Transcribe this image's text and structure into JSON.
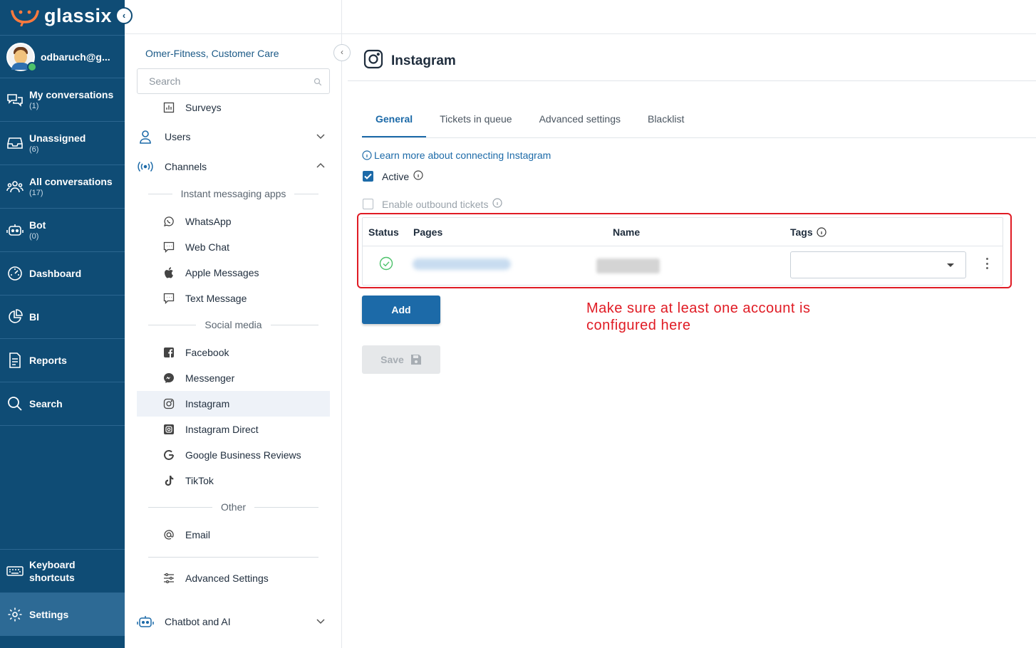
{
  "app": {
    "brand": "glassix",
    "user": "odbaruch@g..."
  },
  "nav": {
    "items": [
      {
        "label": "My conversations",
        "count": "(1)",
        "icon": "chat-icon"
      },
      {
        "label": "Unassigned",
        "count": "(6)",
        "icon": "inbox-icon"
      },
      {
        "label": "All conversations",
        "count": "(17)",
        "icon": "users-icon"
      },
      {
        "label": "Bot",
        "count": "(0)",
        "icon": "bot-icon"
      },
      {
        "label": "Dashboard",
        "count": "",
        "icon": "dashboard-icon"
      },
      {
        "label": "BI",
        "count": "",
        "icon": "pie-chart-icon"
      },
      {
        "label": "Reports",
        "count": "",
        "icon": "report-icon"
      },
      {
        "label": "Search",
        "count": "",
        "icon": "search-icon"
      }
    ],
    "keyboard_line1": "Keyboard",
    "keyboard_line2": "shortcuts",
    "settings": "Settings"
  },
  "panel": {
    "org": "Omer-Fitness, Customer Care",
    "search_placeholder": "Search",
    "surveys": "Surveys",
    "users": "Users",
    "channels": "Channels",
    "im_header": "Instant messaging apps",
    "im_items": [
      "WhatsApp",
      "Web Chat",
      "Apple Messages",
      "Text Message"
    ],
    "social_header": "Social media",
    "social_items": [
      "Facebook",
      "Messenger",
      "Instagram",
      "Instagram Direct",
      "Google Business Reviews",
      "TikTok"
    ],
    "other_header": "Other",
    "email": "Email",
    "advanced": "Advanced Settings",
    "chatbot": "Chatbot and AI"
  },
  "main": {
    "title": "Instagram",
    "tabs": [
      "General",
      "Tickets in queue",
      "Advanced settings",
      "Blacklist"
    ],
    "active_tab": "General",
    "learn_more": "Learn more about connecting Instagram",
    "active_label": "Active",
    "active_checked": true,
    "outbound_label": "Enable outbound tickets",
    "outbound_checked": false,
    "table": {
      "columns": [
        "Status",
        "Pages",
        "Name",
        "Tags"
      ],
      "rows": [
        {
          "status": "connected",
          "tags": ""
        }
      ]
    },
    "add_button": "Add",
    "save_button": "Save",
    "annotation": "Make sure at least one account is configured here"
  },
  "colors": {
    "nav_bg": "#0f4c75",
    "accent": "#1c6aa8",
    "annotation": "#e01b24",
    "success": "#4cc26a"
  }
}
